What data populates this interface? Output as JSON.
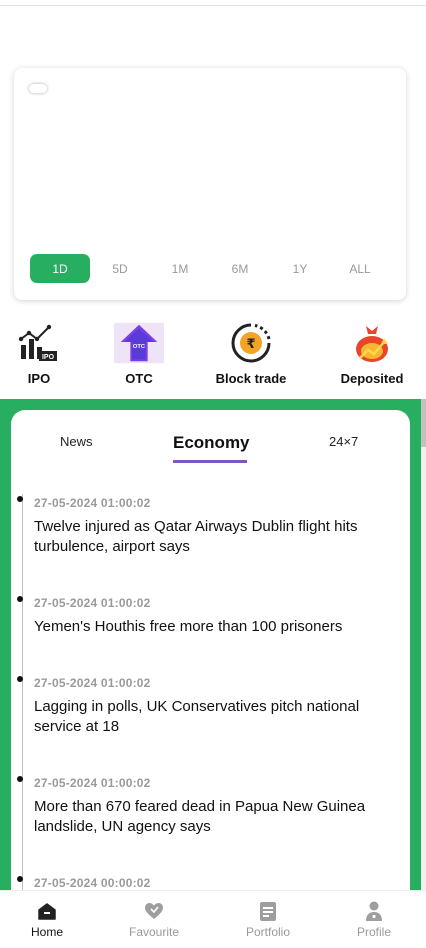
{
  "chart": {
    "ranges": [
      "1D",
      "5D",
      "1M",
      "6M",
      "1Y",
      "ALL"
    ],
    "active_range": "1D"
  },
  "quick_actions": [
    {
      "label": "IPO",
      "icon": "ipo-chart-icon"
    },
    {
      "label": "OTC",
      "icon": "otc-arrow-icon"
    },
    {
      "label": "Block trade",
      "icon": "rupee-coin-icon"
    },
    {
      "label": "Deposited",
      "icon": "money-bag-icon"
    }
  ],
  "news_tabs": [
    "News",
    "Economy",
    "24×7"
  ],
  "active_tab": "Economy",
  "news": [
    {
      "time": "27-05-2024 01:00:02",
      "title": "Twelve injured as Qatar Airways Dublin flight hits turbulence, airport says"
    },
    {
      "time": "27-05-2024 01:00:02",
      "title": "Yemen's Houthis free more than 100 prisoners"
    },
    {
      "time": "27-05-2024 01:00:02",
      "title": "Lagging in polls, UK Conservatives pitch national service at 18"
    },
    {
      "time": "27-05-2024 01:00:02",
      "title": "More than 670 feared dead in Papua New Guinea landslide, UN agency says"
    },
    {
      "time": "27-05-2024 00:00:02",
      "title": ""
    }
  ],
  "bottom_nav": [
    {
      "label": "Home",
      "icon": "home-icon",
      "active": true
    },
    {
      "label": "Favourite",
      "icon": "heart-icon",
      "active": false
    },
    {
      "label": "Portfolio",
      "icon": "document-icon",
      "active": false
    },
    {
      "label": "Profile",
      "icon": "profile-icon",
      "active": false
    }
  ],
  "colors": {
    "accent_green": "#27ae60",
    "tab_underline": "#7e57c2"
  }
}
